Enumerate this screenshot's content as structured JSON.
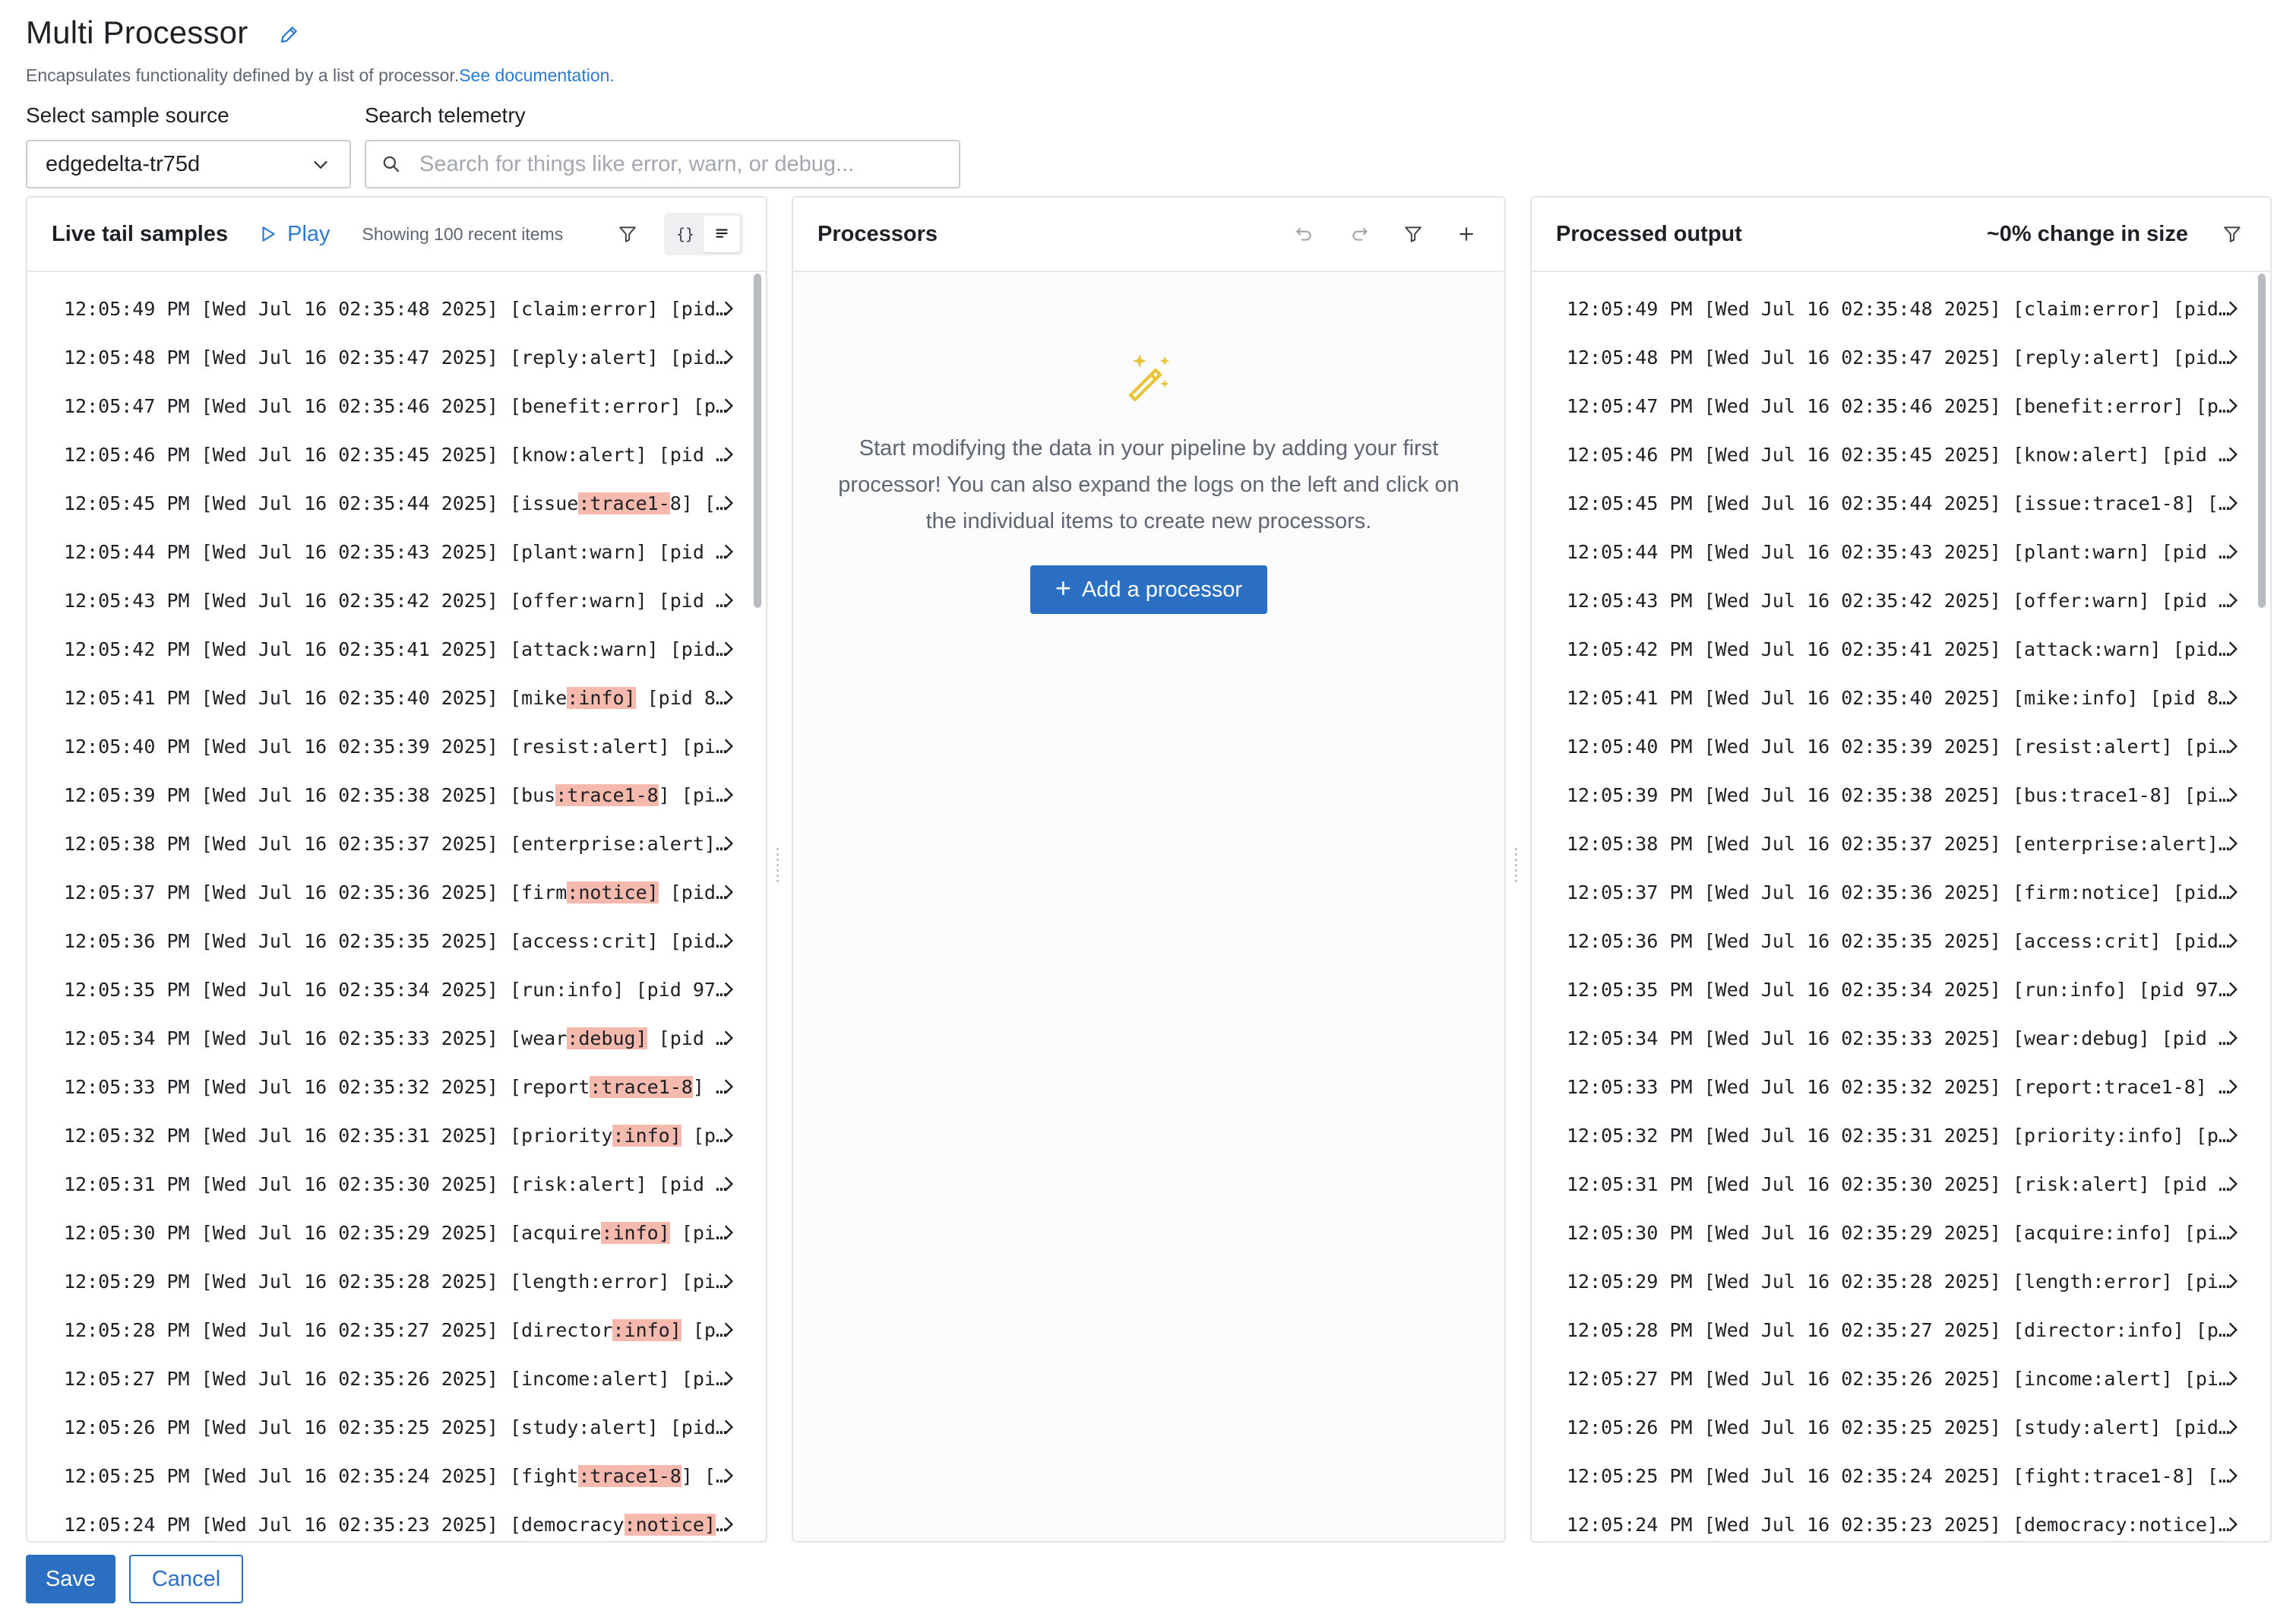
{
  "header": {
    "title": "Multi Processor",
    "description": "Encapsulates functionality defined by a list of processor.",
    "doc_link": "See documentation."
  },
  "controls": {
    "source_label": "Select sample source",
    "source_value": "edgedelta-tr75d",
    "search_label": "Search telemetry",
    "search_placeholder": "Search for things like error, warn, or debug..."
  },
  "live_tail": {
    "title": "Live tail samples",
    "play_label": "Play",
    "showing": "Showing 100 recent items",
    "json_toggle": "{}",
    "rows": [
      {
        "pre": "12:05:49 PM [Wed Jul 16 02:35:48 2025] [claim:error] [pid…",
        "hl": "",
        "post": ""
      },
      {
        "pre": "12:05:48 PM [Wed Jul 16 02:35:47 2025] [reply:alert] [pid…",
        "hl": "",
        "post": ""
      },
      {
        "pre": "12:05:47 PM [Wed Jul 16 02:35:46 2025] [benefit:error] [p…",
        "hl": "",
        "post": ""
      },
      {
        "pre": "12:05:46 PM [Wed Jul 16 02:35:45 2025] [know:alert] [pid …",
        "hl": "",
        "post": ""
      },
      {
        "pre": "12:05:45 PM [Wed Jul 16 02:35:44 2025] [issue",
        "hl": ":trace1-",
        "post": "8] […"
      },
      {
        "pre": "12:05:44 PM [Wed Jul 16 02:35:43 2025] [plant:warn] [pid …",
        "hl": "",
        "post": ""
      },
      {
        "pre": "12:05:43 PM [Wed Jul 16 02:35:42 2025] [offer:warn] [pid …",
        "hl": "",
        "post": ""
      },
      {
        "pre": "12:05:42 PM [Wed Jul 16 02:35:41 2025] [attack:warn] [pid…",
        "hl": "",
        "post": ""
      },
      {
        "pre": "12:05:41 PM [Wed Jul 16 02:35:40 2025] [mike",
        "hl": ":info]",
        "post": " [pid 8…"
      },
      {
        "pre": "12:05:40 PM [Wed Jul 16 02:35:39 2025] [resist:alert] [pi…",
        "hl": "",
        "post": ""
      },
      {
        "pre": "12:05:39 PM [Wed Jul 16 02:35:38 2025] [bus",
        "hl": ":trace1-8",
        "post": "] [pi…"
      },
      {
        "pre": "12:05:38 PM [Wed Jul 16 02:35:37 2025] [enterprise:alert]…",
        "hl": "",
        "post": ""
      },
      {
        "pre": "12:05:37 PM [Wed Jul 16 02:35:36 2025] [firm",
        "hl": ":notice]",
        "post": " [pid…"
      },
      {
        "pre": "12:05:36 PM [Wed Jul 16 02:35:35 2025] [access:crit] [pid…",
        "hl": "",
        "post": ""
      },
      {
        "pre": "12:05:35 PM [Wed Jul 16 02:35:34 2025] [run:info] [pid 97…",
        "hl": "",
        "post": ""
      },
      {
        "pre": "12:05:34 PM [Wed Jul 16 02:35:33 2025] [wear",
        "hl": ":debug]",
        "post": " [pid …"
      },
      {
        "pre": "12:05:33 PM [Wed Jul 16 02:35:32 2025] [report",
        "hl": ":trace1-8",
        "post": "] …"
      },
      {
        "pre": "12:05:32 PM [Wed Jul 16 02:35:31 2025] [priority",
        "hl": ":info]",
        "post": " [p…"
      },
      {
        "pre": "12:05:31 PM [Wed Jul 16 02:35:30 2025] [risk:alert] [pid …",
        "hl": "",
        "post": ""
      },
      {
        "pre": "12:05:30 PM [Wed Jul 16 02:35:29 2025] [acquire",
        "hl": ":info]",
        "post": " [pi…"
      },
      {
        "pre": "12:05:29 PM [Wed Jul 16 02:35:28 2025] [length:error] [pi…",
        "hl": "",
        "post": ""
      },
      {
        "pre": "12:05:28 PM [Wed Jul 16 02:35:27 2025] [director",
        "hl": ":info]",
        "post": " [p…"
      },
      {
        "pre": "12:05:27 PM [Wed Jul 16 02:35:26 2025] [income:alert] [pi…",
        "hl": "",
        "post": ""
      },
      {
        "pre": "12:05:26 PM [Wed Jul 16 02:35:25 2025] [study:alert] [pid…",
        "hl": "",
        "post": ""
      },
      {
        "pre": "12:05:25 PM [Wed Jul 16 02:35:24 2025] [fight",
        "hl": ":trace1-8",
        "post": "] […"
      },
      {
        "pre": "12:05:24 PM [Wed Jul 16 02:35:23 2025] [democracy",
        "hl": ":notice]",
        "post": "…"
      }
    ]
  },
  "processors": {
    "title": "Processors",
    "empty_text": "Start modifying the data in your pipeline by adding your first processor! You can also expand the logs on the left and click on the individual items to create new processors.",
    "add_label": "Add a processor"
  },
  "output": {
    "title": "Processed output",
    "size_change": "~0% change in size",
    "rows": [
      "12:05:49 PM [Wed Jul 16 02:35:48 2025] [claim:error] [pid…",
      "12:05:48 PM [Wed Jul 16 02:35:47 2025] [reply:alert] [pid…",
      "12:05:47 PM [Wed Jul 16 02:35:46 2025] [benefit:error] [p…",
      "12:05:46 PM [Wed Jul 16 02:35:45 2025] [know:alert] [pid …",
      "12:05:45 PM [Wed Jul 16 02:35:44 2025] [issue:trace1-8] […",
      "12:05:44 PM [Wed Jul 16 02:35:43 2025] [plant:warn] [pid …",
      "12:05:43 PM [Wed Jul 16 02:35:42 2025] [offer:warn] [pid …",
      "12:05:42 PM [Wed Jul 16 02:35:41 2025] [attack:warn] [pid…",
      "12:05:41 PM [Wed Jul 16 02:35:40 2025] [mike:info] [pid 8…",
      "12:05:40 PM [Wed Jul 16 02:35:39 2025] [resist:alert] [pi…",
      "12:05:39 PM [Wed Jul 16 02:35:38 2025] [bus:trace1-8] [pi…",
      "12:05:38 PM [Wed Jul 16 02:35:37 2025] [enterprise:alert]…",
      "12:05:37 PM [Wed Jul 16 02:35:36 2025] [firm:notice] [pid…",
      "12:05:36 PM [Wed Jul 16 02:35:35 2025] [access:crit] [pid…",
      "12:05:35 PM [Wed Jul 16 02:35:34 2025] [run:info] [pid 97…",
      "12:05:34 PM [Wed Jul 16 02:35:33 2025] [wear:debug] [pid …",
      "12:05:33 PM [Wed Jul 16 02:35:32 2025] [report:trace1-8] …",
      "12:05:32 PM [Wed Jul 16 02:35:31 2025] [priority:info] [p…",
      "12:05:31 PM [Wed Jul 16 02:35:30 2025] [risk:alert] [pid …",
      "12:05:30 PM [Wed Jul 16 02:35:29 2025] [acquire:info] [pi…",
      "12:05:29 PM [Wed Jul 16 02:35:28 2025] [length:error] [pi…",
      "12:05:28 PM [Wed Jul 16 02:35:27 2025] [director:info] [p…",
      "12:05:27 PM [Wed Jul 16 02:35:26 2025] [income:alert] [pi…",
      "12:05:26 PM [Wed Jul 16 02:35:25 2025] [study:alert] [pid…",
      "12:05:25 PM [Wed Jul 16 02:35:24 2025] [fight:trace1-8] […",
      "12:05:24 PM [Wed Jul 16 02:35:23 2025] [democracy:notice]…"
    ]
  },
  "footer": {
    "save_label": "Save",
    "cancel_label": "Cancel"
  },
  "colors": {
    "accent": "#2a6fc1",
    "link": "#2b7bd4",
    "highlight": "#f6b9ad",
    "wand": "#e8c53a"
  }
}
